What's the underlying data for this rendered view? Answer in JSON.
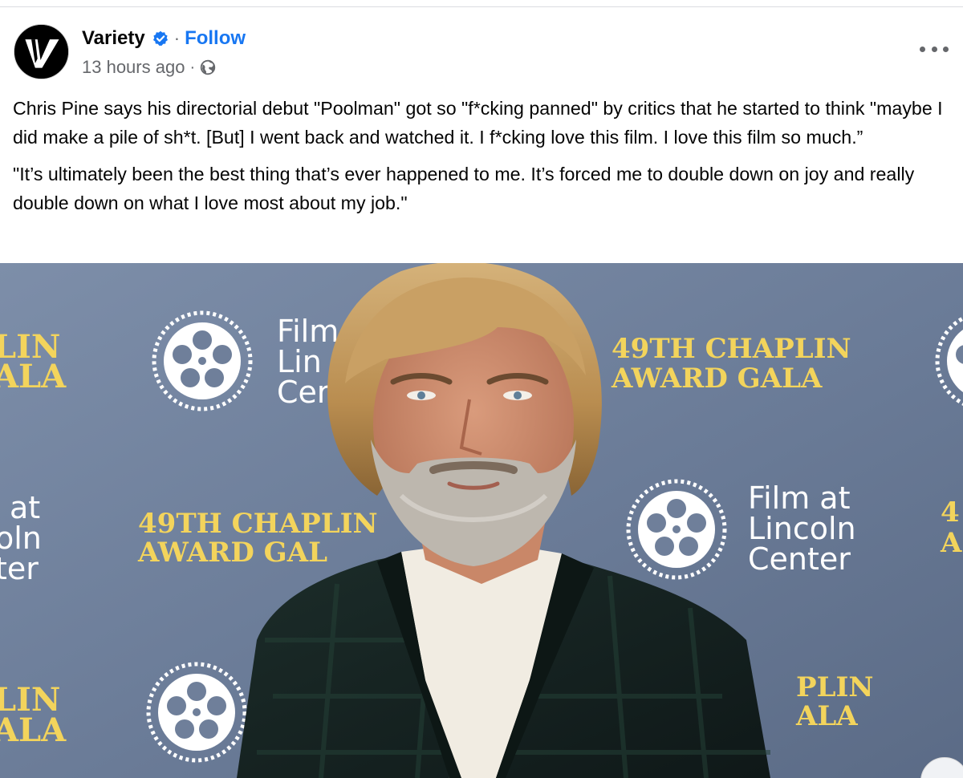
{
  "post": {
    "page_name": "Variety",
    "follow_label": "Follow",
    "separator": "·",
    "timestamp": "13 hours ago",
    "meta_separator": "·",
    "verified_icon": "verified-badge-icon",
    "audience_icon": "globe-icon",
    "paragraphs": [
      "Chris Pine says his directorial debut \"Poolman\" got so \"f*cking panned\" by critics that he started to think \"maybe I did make a pile of sh*t. [But] I went back and watched it. I f*cking love this film. I love this film so much.”",
      "\"It’s ultimately been the best thing that’s ever happened to me. It’s forced me to double down on joy and really double down on what I love most about my job.\""
    ]
  },
  "photo": {
    "backdrop_text": {
      "gala_line_1": "49TH CHAPLIN",
      "gala_line_2": "AWARD GALA",
      "org_line_1": "Film at",
      "org_line_2": "Lincoln",
      "org_line_3": "Center",
      "crop_left_1": "LIN",
      "crop_left_2": "ALA",
      "crop_left_org_1": "at",
      "crop_left_org_2": "oln",
      "crop_left_org_3": "ter",
      "crop_film": "Film",
      "crop_lin": "Lin",
      "crop_cer": "Cer",
      "crop_gala_mid_1": "49TH CHAPLIN",
      "crop_gala_mid_2": "AWARD GAL",
      "crop_right_1": "PLIN",
      "crop_right_2": "ALA",
      "crop_right_edge_1": "4",
      "crop_right_edge_2": "A"
    }
  },
  "colors": {
    "brand_blue": "#1877f2",
    "secondary_text": "#65676b",
    "backdrop_blue": "#6f7f9a",
    "gala_gold": "#f3d45c"
  }
}
